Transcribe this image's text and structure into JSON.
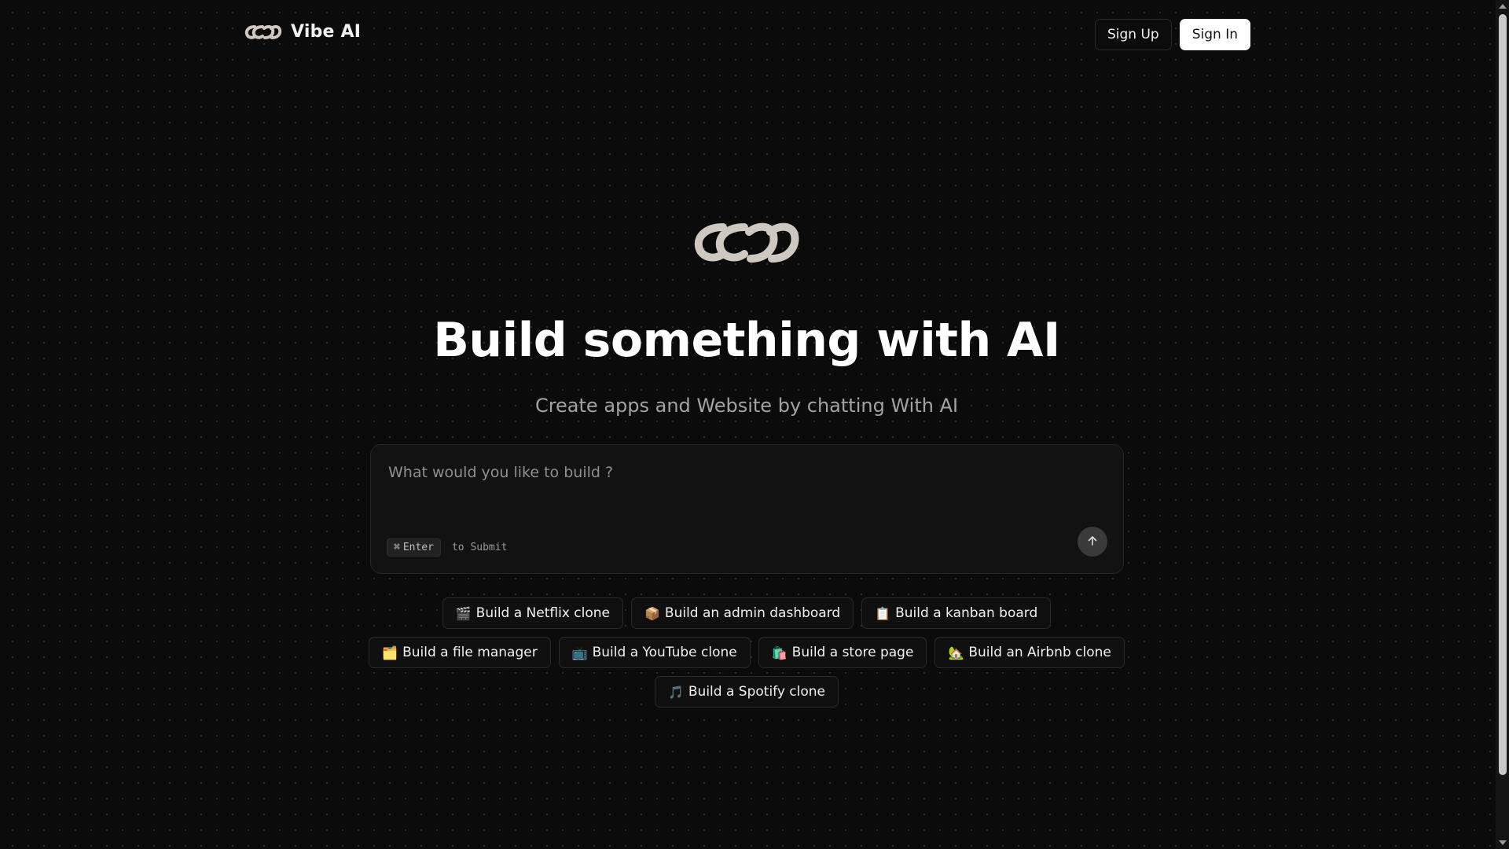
{
  "header": {
    "brand_name": "Vibe AI",
    "sign_up_label": "Sign Up",
    "sign_in_label": "Sign In"
  },
  "hero": {
    "title": "Build something with AI",
    "subtitle": "Create apps and Website by chatting With AI"
  },
  "prompt": {
    "placeholder": "What would you like to build ?",
    "shortcut_symbol": "⌘",
    "shortcut_key": "Enter",
    "shortcut_hint": "to Submit",
    "submit_icon": "arrow-up-icon"
  },
  "suggestions": {
    "row1": [
      {
        "emoji": "🎬",
        "label": "Build a Netflix clone"
      },
      {
        "emoji": "📦",
        "label": "Build an admin dashboard"
      },
      {
        "emoji": "📋",
        "label": "Build a kanban board"
      }
    ],
    "row2": [
      {
        "emoji": "🗂️",
        "label": "Build a file manager"
      },
      {
        "emoji": "📺",
        "label": "Build a YouTube clone"
      },
      {
        "emoji": "🛍️",
        "label": "Build a store page"
      },
      {
        "emoji": "🏡",
        "label": "Build an Airbnb clone"
      }
    ],
    "row3": [
      {
        "emoji": "🎵",
        "label": "Build a Spotify clone"
      }
    ]
  },
  "colors": {
    "background": "#0b0b0b",
    "surface": "#121212",
    "border": "#262626",
    "text_primary": "#ffffff",
    "text_muted": "#a3a3a3",
    "logo": "#cfc8c0"
  },
  "icons": {
    "brand_logo": "infinity-chain-logo-icon",
    "hero_logo": "infinity-chain-logo-icon"
  }
}
